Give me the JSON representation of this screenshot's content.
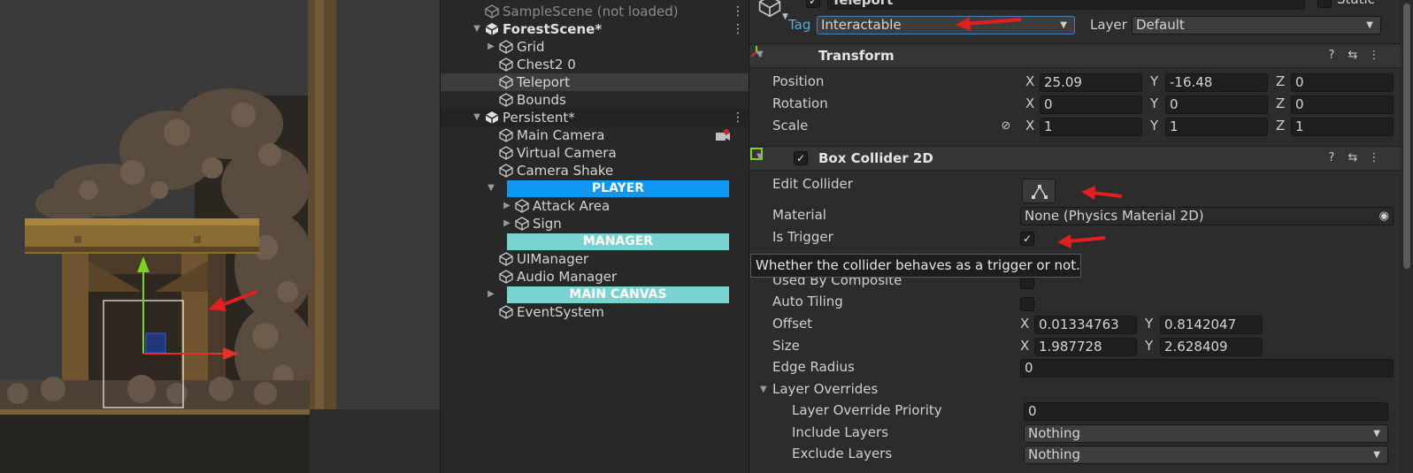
{
  "hierarchy": {
    "rows": {
      "sample_scene": "SampleScene (not loaded)",
      "forest_scene": "ForestScene*",
      "grid": "Grid",
      "chest": "Chest2 0",
      "teleport": "Teleport",
      "bounds": "Bounds",
      "persistent": "Persistent*",
      "main_camera": "Main Camera",
      "virtual_camera": "Virtual Camera",
      "camera_shake": "Camera Shake",
      "attack_area": "Attack Area",
      "sign": "Sign",
      "ui_manager": "UIManager",
      "audio_manager": "Audio Manager",
      "event_system": "EventSystem"
    },
    "banners": {
      "player": "PLAYER",
      "manager": "MANAGER",
      "main_canvas": "MAIN CANVAS"
    },
    "colors": {
      "player": "#0e98f4",
      "manager": "#79d3d0",
      "main_canvas": "#79d3d0"
    }
  },
  "inspector": {
    "header": {
      "object_name": "Teleport",
      "static_label": "Static",
      "tag_label": "Tag",
      "tag_value": "Interactable",
      "layer_label": "Layer",
      "layer_value": "Default"
    },
    "transform": {
      "title": "Transform",
      "position_label": "Position",
      "rotation_label": "Rotation",
      "scale_label": "Scale",
      "position": {
        "x": "25.09",
        "y": "-16.48",
        "z": "0"
      },
      "rotation": {
        "x": "0",
        "y": "0",
        "z": "0"
      },
      "scale": {
        "x": "1",
        "y": "1",
        "z": "1"
      }
    },
    "box_collider": {
      "title": "Box Collider 2D",
      "edit_collider_label": "Edit Collider",
      "material_label": "Material",
      "material_value": "None (Physics Material 2D)",
      "is_trigger_label": "Is Trigger",
      "is_trigger_checked": "✓",
      "used_by_composite_label": "Used By Composite",
      "auto_tiling_label": "Auto Tiling",
      "offset_label": "Offset",
      "offset": {
        "x": "0.01334763",
        "y": "0.8142047"
      },
      "size_label": "Size",
      "size": {
        "x": "1.987728",
        "y": "2.628409"
      },
      "edge_radius_label": "Edge Radius",
      "edge_radius_value": "0",
      "layer_overrides_label": "Layer Overrides",
      "layer_override_priority_label": "Layer Override Priority",
      "layer_override_priority_value": "0",
      "include_layers_label": "Include Layers",
      "include_layers_value": "Nothing",
      "exclude_layers_label": "Exclude Layers",
      "exclude_layers_value": "Nothing"
    },
    "axis_labels": {
      "x": "X",
      "y": "Y",
      "z": "Z"
    },
    "tooltip": "Whether the collider behaves as a trigger or not."
  },
  "colors": {
    "annotation_arrow": "#e02020",
    "accent_blue": "#0e98f4",
    "collider_green": "#7ed321"
  }
}
